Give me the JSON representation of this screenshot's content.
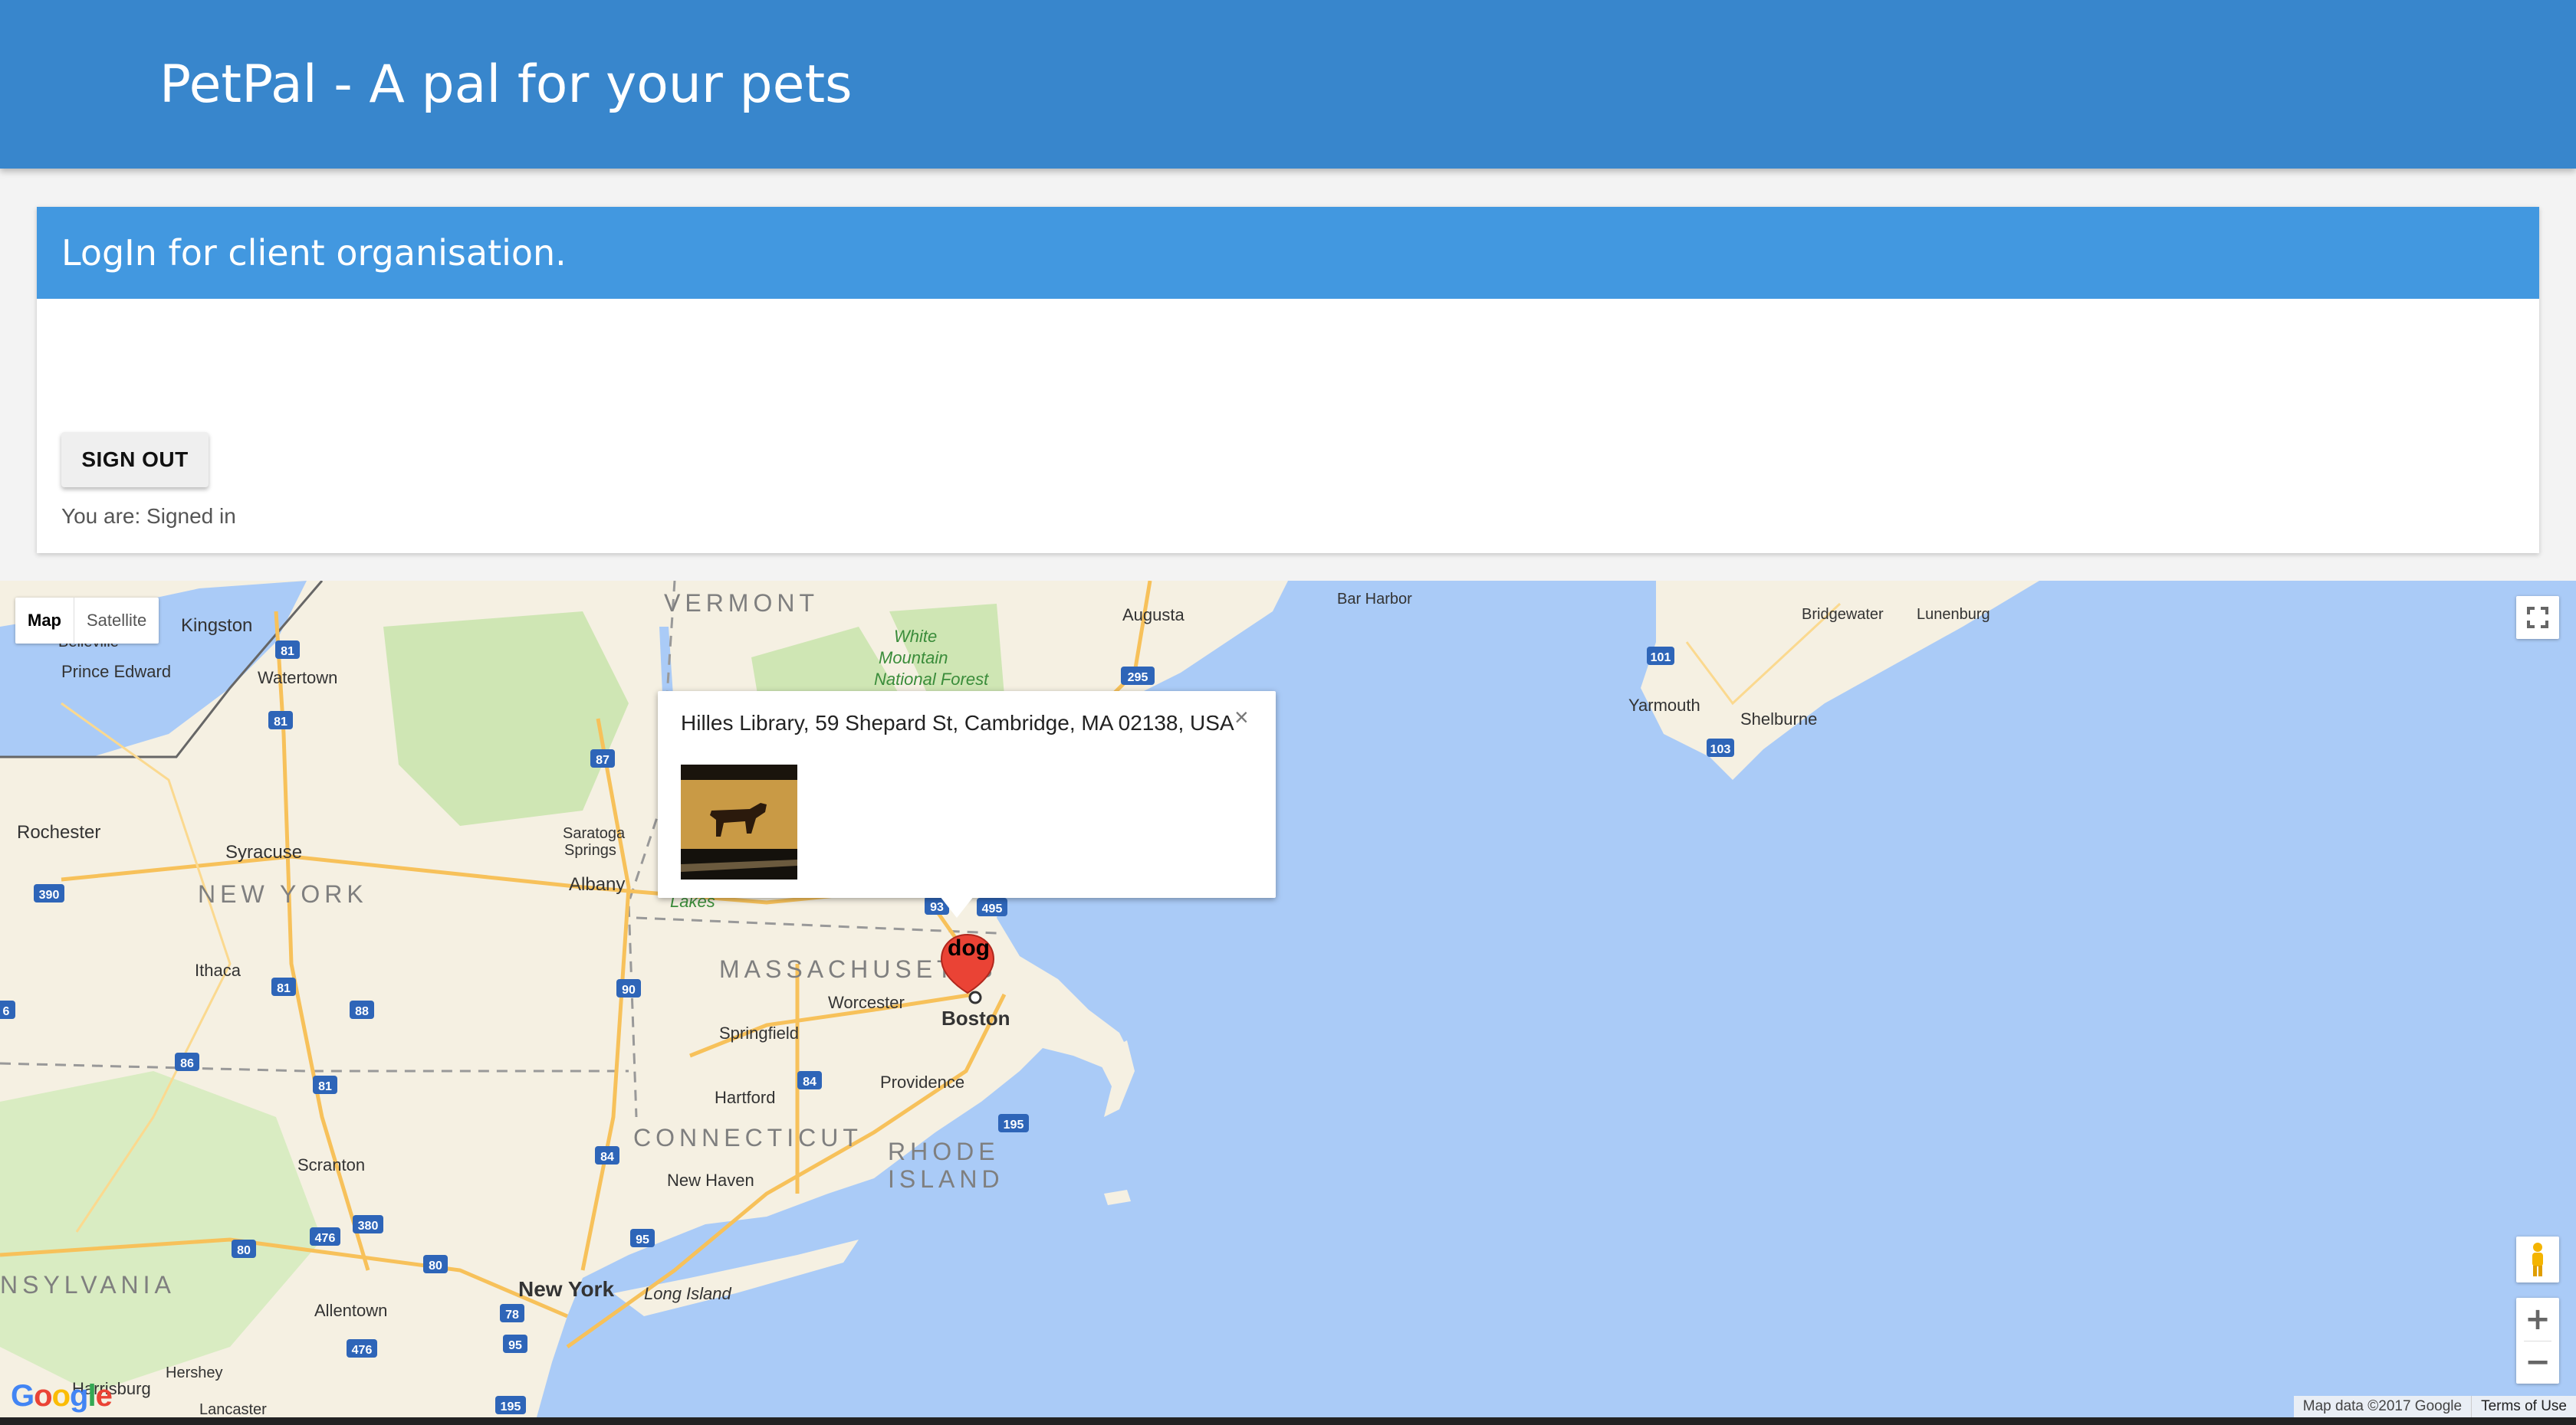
{
  "header": {
    "title": "PetPal - A pal for your pets"
  },
  "login_card": {
    "title": "LogIn for client organisation.",
    "sign_out_label": "SIGN OUT",
    "status_text": "You are: Signed in"
  },
  "map": {
    "type_controls": {
      "map_label": "Map",
      "satellite_label": "Satellite",
      "selected": "Map"
    },
    "info_window": {
      "address": "Hilles Library, 59 Shepard St, Cambridge, MA 02138, USA",
      "close_glyph": "×",
      "photo": "dog-photo"
    },
    "marker": {
      "label": "dog",
      "color": "#ea4335"
    },
    "zoom": {
      "in": "+",
      "out": "−"
    },
    "attribution": {
      "data": "Map data ©2017 Google",
      "terms": "Terms of Use"
    },
    "logo": [
      "G",
      "o",
      "o",
      "g",
      "l",
      "e"
    ],
    "logo_colors": [
      "#4285f4",
      "#ea4335",
      "#fbbc05",
      "#4285f4",
      "#34a853",
      "#ea4335"
    ],
    "colors": {
      "water": "#aacbf7",
      "land": "#f5f0e2",
      "forest": "#cfe6b4",
      "highway": "#f7c15a"
    },
    "place_labels": [
      "VERMONT",
      "White",
      "Mountain",
      "National Forest",
      "Augusta",
      "Bar Harbor",
      "Bridgewater",
      "Lunenburg",
      "Kingston",
      "Belleville",
      "Prince Edward",
      "Watertown",
      "Yarmouth",
      "Shelburne",
      "Rochester",
      "Syracuse",
      "Saratoga",
      "Springs",
      "NEW YORK",
      "Albany",
      "Lakes",
      "MASSACHUSETTS",
      "Worcester",
      "Boston",
      "Ithaca",
      "Springfield",
      "Providence",
      "Hartford",
      "CONNECTICUT",
      "RHODE",
      "ISLAND",
      "Scranton",
      "New Haven",
      "NSYLVANIA",
      "New York",
      "Long Island",
      "Allentown",
      "Hershey",
      "Harrisburg",
      "Lancaster"
    ],
    "route_shields": [
      "81",
      "81",
      "87",
      "295",
      "101",
      "103",
      "390",
      "93",
      "495",
      "90",
      "81",
      "88",
      "86",
      "81",
      "84",
      "84",
      "195",
      "476",
      "380",
      "95",
      "80",
      "80",
      "78",
      "95",
      "476",
      "195",
      "6"
    ]
  }
}
